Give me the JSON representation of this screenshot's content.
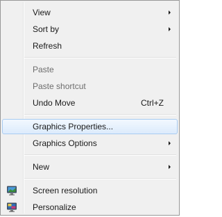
{
  "menu": {
    "items": [
      {
        "label": "View",
        "submenu": true
      },
      {
        "label": "Sort by",
        "submenu": true
      },
      {
        "label": "Refresh"
      },
      {
        "label": "Paste",
        "disabled": true
      },
      {
        "label": "Paste shortcut",
        "disabled": true
      },
      {
        "label": "Undo Move",
        "shortcut": "Ctrl+Z"
      },
      {
        "label": "Graphics Properties...",
        "highlighted": true
      },
      {
        "label": "Graphics Options",
        "submenu": true
      },
      {
        "label": "New",
        "submenu": true
      },
      {
        "label": "Screen resolution",
        "icon": "monitor-icon"
      },
      {
        "label": "Personalize",
        "icon": "personalize-icon"
      }
    ]
  },
  "colors": {
    "menu_background": "#f0f0f0",
    "menu_border": "#979797",
    "highlight_border": "#a8cbf1",
    "highlight_fill": "#dcebfc",
    "disabled_text": "#6d6d6d"
  }
}
